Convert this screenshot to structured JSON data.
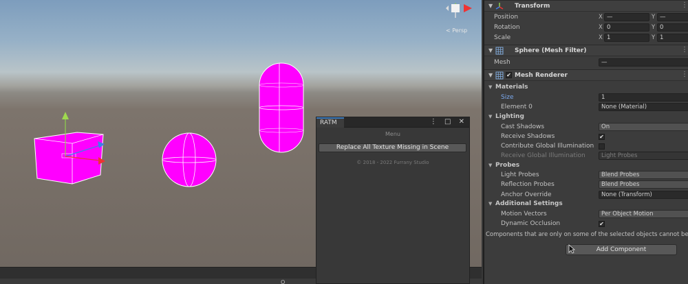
{
  "scene": {
    "perspective_label": "< Persp",
    "bottom_bar_text": "Q",
    "colors": {
      "missing_material": "#ff00ff",
      "grid_line": "#ffffff"
    }
  },
  "ratm": {
    "tab_label": "RATM",
    "tools": "⋮ □ ✕",
    "menu_label": "Menu",
    "button_label": "Replace All Texture Missing in Scene",
    "copyright": "© 2018 - 2022 Furrany Studio"
  },
  "inspector": {
    "transform": {
      "title": "Transform",
      "rows": [
        {
          "label": "Position",
          "x_axis": "X",
          "x": "—",
          "y_axis": "Y",
          "y": "—"
        },
        {
          "label": "Rotation",
          "x_axis": "X",
          "x": "0",
          "y_axis": "Y",
          "y": "0"
        },
        {
          "label": "Scale",
          "x_axis": "X",
          "x": "1",
          "y_axis": "Y",
          "y": "1"
        }
      ]
    },
    "mesh_filter": {
      "title": "Sphere (Mesh Filter)",
      "mesh_label": "Mesh",
      "mesh_value": "—"
    },
    "mesh_renderer": {
      "title": "Mesh Renderer",
      "enabled_check": "✔",
      "materials": {
        "section": "Materials",
        "size_label": "Size",
        "size_value": "1",
        "element0_label": "Element 0",
        "element0_value": "None (Material)"
      },
      "lighting": {
        "section": "Lighting",
        "cast_shadows_label": "Cast Shadows",
        "cast_shadows_value": "On",
        "receive_shadows_label": "Receive Shadows",
        "receive_shadows_check": "✔",
        "contribute_gi_label": "Contribute Global Illumination",
        "receive_gi_label": "Receive Global Illumination",
        "receive_gi_value": "Light Probes"
      },
      "probes": {
        "section": "Probes",
        "light_probes_label": "Light Probes",
        "light_probes_value": "Blend Probes",
        "reflection_probes_label": "Reflection Probes",
        "reflection_probes_value": "Blend Probes",
        "anchor_override_label": "Anchor Override",
        "anchor_override_value": "None (Transform)"
      },
      "additional": {
        "section": "Additional Settings",
        "motion_vectors_label": "Motion Vectors",
        "motion_vectors_value": "Per Object Motion",
        "dynamic_occlusion_label": "Dynamic Occlusion",
        "dynamic_occlusion_check": "✔"
      }
    },
    "warning": "Components that are only on some of the selected objects cannot be multi",
    "add_component_label": "Add Component"
  }
}
